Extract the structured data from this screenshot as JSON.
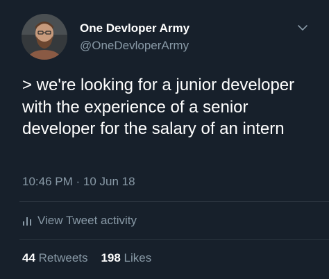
{
  "author": {
    "display_name": "One Devloper Army",
    "handle": "@OneDevloperArmy",
    "avatar_icon": "user-avatar-photo"
  },
  "menu": {
    "icon": "chevron-down-icon"
  },
  "tweet": {
    "text": "> we're looking for a junior developer with the experience of a senior developer for the salary of an intern",
    "timestamp": "10:46 PM · 10 Jun 18"
  },
  "activity": {
    "icon": "bar-chart-icon",
    "label": "View Tweet activity"
  },
  "stats": {
    "retweets_count": "44",
    "retweets_label": "Retweets",
    "likes_count": "198",
    "likes_label": "Likes"
  },
  "colors": {
    "background": "#17202b",
    "primary_text": "#ffffff",
    "secondary_text": "#8899a6",
    "divider": "#2c3640"
  }
}
